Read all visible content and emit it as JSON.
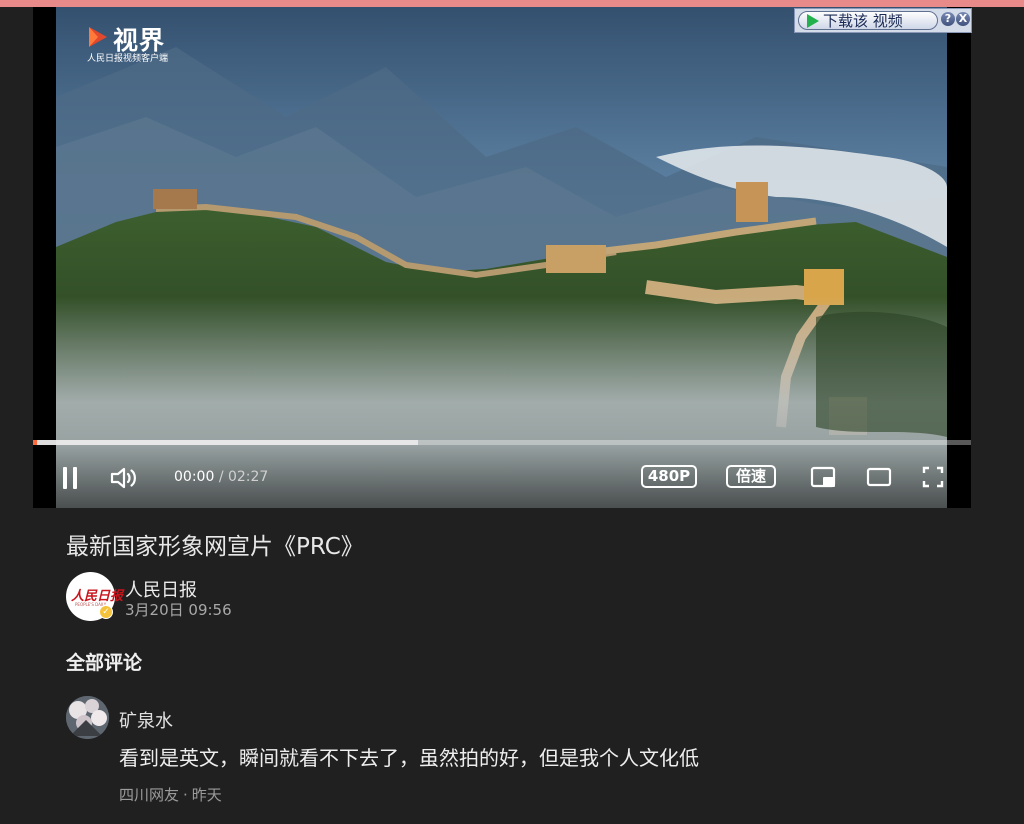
{
  "logo": {
    "name": "视界",
    "sub": "人民日报视频客户端"
  },
  "download_bar": {
    "label": "下载该 视频",
    "help": "?",
    "close": "X"
  },
  "player": {
    "progress_played": 0.004,
    "progress_buffered": 0.41,
    "time_current": "00:00",
    "time_separator": "/",
    "time_total": "02:27",
    "quality": "480P",
    "speed": "倍速",
    "accent_color": "#ff6a3d"
  },
  "video": {
    "title": "最新国家形象网宣片《PRC》"
  },
  "author": {
    "name": "人民日报",
    "date": "3月20日 09:56",
    "avatar_text": "人民日报",
    "avatar_sub": "PEOPLE'S DAILY",
    "verified_icon": "check-badge-icon"
  },
  "comments": {
    "heading": "全部评论",
    "items": [
      {
        "user": "矿泉水",
        "text": "看到是英文，瞬间就看不下去了，虽然拍的好，但是我个人文化低",
        "location": "四川网友",
        "dot": "·",
        "time": "昨天"
      }
    ]
  }
}
